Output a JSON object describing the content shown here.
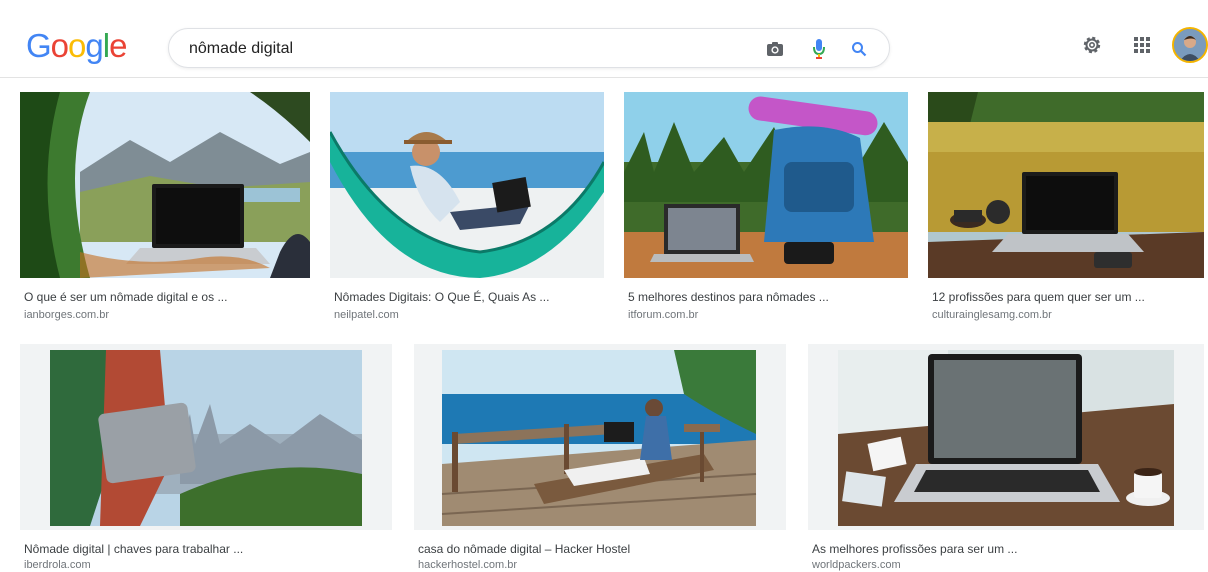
{
  "header": {
    "logo": [
      "G",
      "o",
      "o",
      "g",
      "l",
      "e"
    ],
    "logo_colors": [
      "#4285f4",
      "#ea4335",
      "#fbbc05",
      "#4285f4",
      "#34a853",
      "#ea4335"
    ],
    "search_query": "nômade digital",
    "icons": [
      "camera-icon",
      "microphone-icon",
      "search-icon",
      "gear-icon",
      "apps-grid-icon",
      "avatar"
    ]
  },
  "results": [
    {
      "title": "O que é ser um nômade digital e os ...",
      "domain": "ianborges.com.br"
    },
    {
      "title": "Nômades Digitais: O Que É, Quais As ...",
      "domain": "neilpatel.com"
    },
    {
      "title": "5 melhores destinos para nômades ...",
      "domain": "itforum.com.br"
    },
    {
      "title": "12 profissões para quem quer ser um ...",
      "domain": "culturainglesamg.com.br"
    },
    {
      "title": "Nômade digital | chaves para trabalhar ...",
      "domain": "iberdrola.com"
    },
    {
      "title": "casa do nômade digital – Hacker Hostel",
      "domain": "hackerhostel.com.br"
    },
    {
      "title": "As melhores profissões para ser um ...",
      "domain": "worldpackers.com"
    }
  ]
}
